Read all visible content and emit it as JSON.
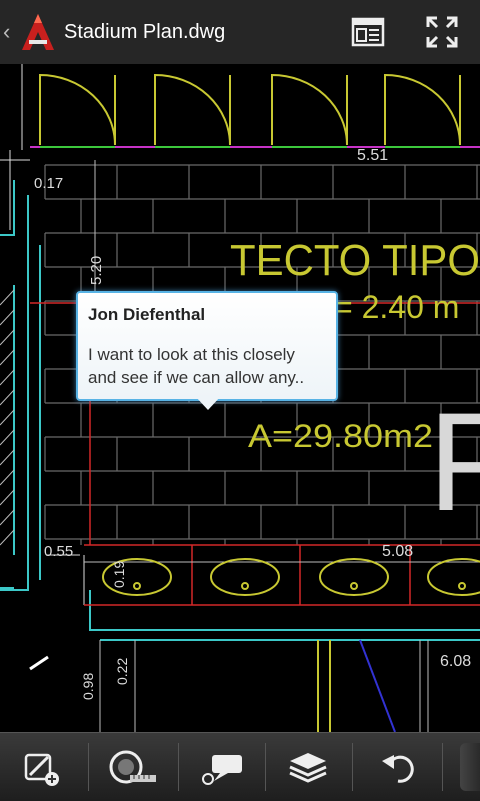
{
  "header": {
    "file_name": "Stadium Plan.dwg",
    "app_icon": "autocad-logo-icon",
    "back_icon": "chevron-left-icon",
    "actions": [
      {
        "icon": "layout-sheet-icon"
      },
      {
        "icon": "fullscreen-icon"
      }
    ]
  },
  "drawing": {
    "labels": {
      "dim_551": "5.51",
      "dim_017": "0.17",
      "dim_520": "5.20",
      "tecto": "TECTO  TIPO",
      "height": "= 2.40  m",
      "area": "A=29.80m2",
      "big_letter": "P",
      "dim_055": "0.55",
      "dim_508": "5.08",
      "dim_019": "0.19",
      "dim_022": "0.22",
      "dim_098": "0.98",
      "dim_608": "6.08"
    }
  },
  "comment": {
    "author": "Jon Diefenthal",
    "text": "I want to look at this closely and see if we can allow any.."
  },
  "toolbar": {
    "items": [
      {
        "icon": "markup-pen-icon"
      },
      {
        "icon": "measure-tape-icon"
      },
      {
        "icon": "comment-icon"
      },
      {
        "icon": "layers-icon"
      },
      {
        "icon": "undo-icon"
      }
    ]
  },
  "colors": {
    "cad_yellow": "#c8c832",
    "cad_cyan": "#3cc8c8",
    "cad_red": "#d22828",
    "cad_magenta": "#c832c8",
    "comment_border": "#58b3e5"
  }
}
